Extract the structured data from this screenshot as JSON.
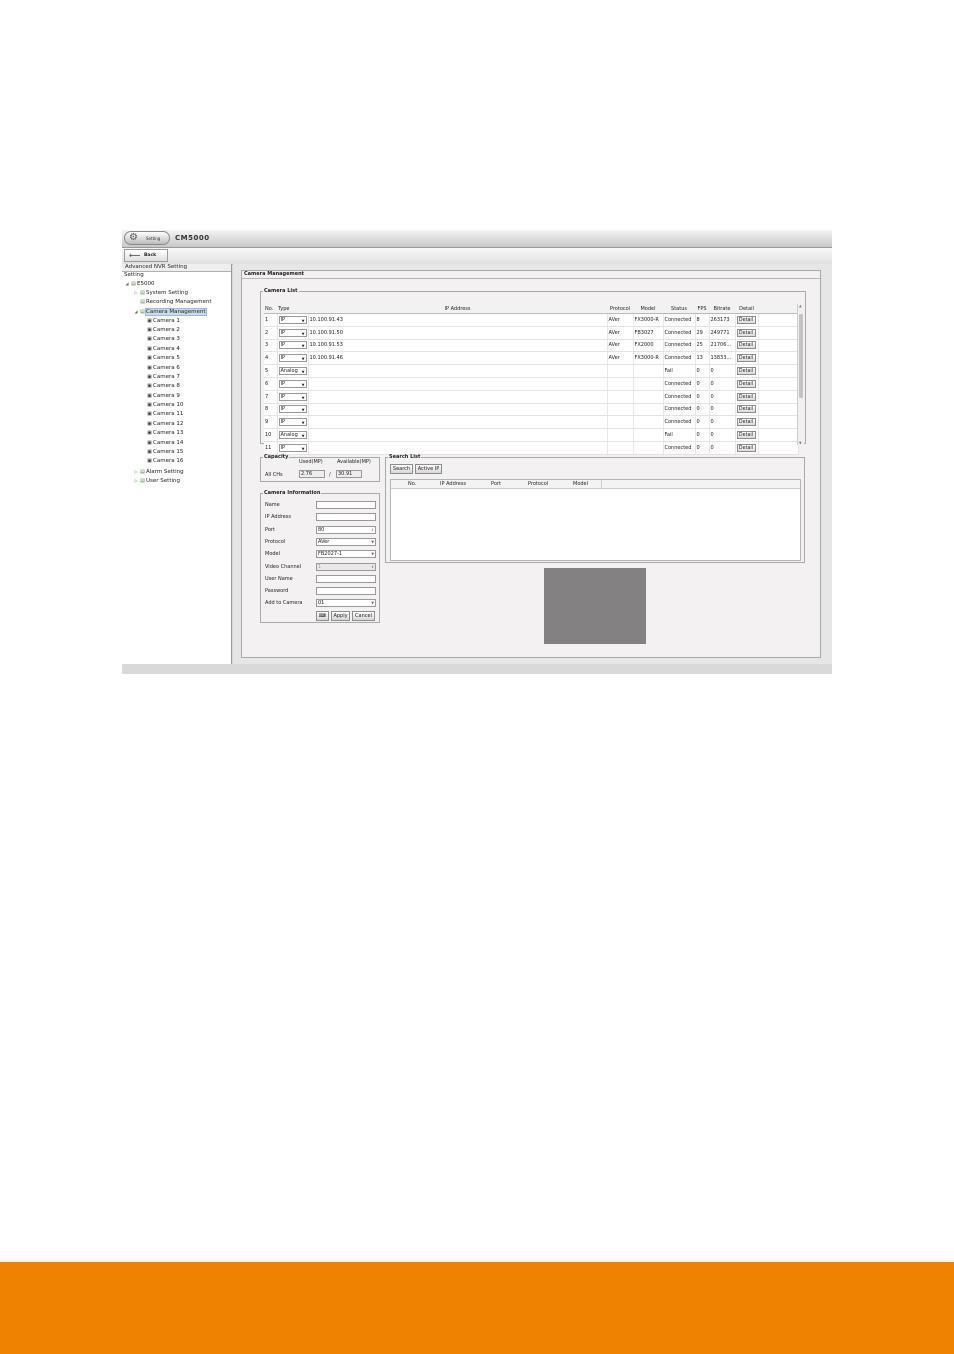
{
  "header": {
    "setting_label": "Setting",
    "app_title": "CM5000",
    "back_label": "Back"
  },
  "sidebar": {
    "header": "Advanced NVR Setting",
    "sub": "Setting",
    "tree": [
      {
        "label": "E5000",
        "level": 0,
        "arrow": "◢"
      },
      {
        "label": "System Setting",
        "level": 1,
        "arrow": "▷"
      },
      {
        "label": "Recording Management",
        "level": 1,
        "arrow": ""
      },
      {
        "label": "Camera Management",
        "level": 1,
        "arrow": "◢",
        "selected": true
      },
      {
        "label": "Camera 1",
        "level": 2
      },
      {
        "label": "Camera 2",
        "level": 2
      },
      {
        "label": "Camera 3",
        "level": 2
      },
      {
        "label": "Camera 4",
        "level": 2
      },
      {
        "label": "Camera 5",
        "level": 2
      },
      {
        "label": "Camera 6",
        "level": 2
      },
      {
        "label": "Camera 7",
        "level": 2
      },
      {
        "label": "Camera 8",
        "level": 2
      },
      {
        "label": "Camera 9",
        "level": 2
      },
      {
        "label": "Camera 10",
        "level": 2
      },
      {
        "label": "Camera 11",
        "level": 2
      },
      {
        "label": "Camera 12",
        "level": 2
      },
      {
        "label": "Camera 13",
        "level": 2
      },
      {
        "label": "Camera 14",
        "level": 2
      },
      {
        "label": "Camera 15",
        "level": 2
      },
      {
        "label": "Camera 16",
        "level": 2
      },
      {
        "label": "Alarm Setting",
        "level": 1,
        "arrow": "▷"
      },
      {
        "label": "User Setting",
        "level": 1,
        "arrow": "▷"
      }
    ]
  },
  "panel": {
    "title": "Camera Management"
  },
  "camera_list": {
    "legend": "Camera List",
    "columns": [
      "No.",
      "Type",
      "IP Address",
      "Protocol",
      "Model",
      "Status",
      "FPS",
      "Bitrate",
      "Detail"
    ],
    "detail_label": "Detail",
    "rows": [
      {
        "no": "1",
        "type": "IP",
        "ip": "10.100.91.43",
        "protocol": "AVer",
        "model": "FX3000-R",
        "status": "Connected",
        "fps": "8",
        "bitrate": "263173"
      },
      {
        "no": "2",
        "type": "IP",
        "ip": "10.100.91.50",
        "protocol": "AVer",
        "model": "FB3027",
        "status": "Connected",
        "fps": "29",
        "bitrate": "249771"
      },
      {
        "no": "3",
        "type": "IP",
        "ip": "10.100.91.53",
        "protocol": "AVer",
        "model": "FX2000",
        "status": "Connected",
        "fps": "25",
        "bitrate": "21706..."
      },
      {
        "no": "4",
        "type": "IP",
        "ip": "10.100.91.46",
        "protocol": "AVer",
        "model": "FX3000-R",
        "status": "Connected",
        "fps": "13",
        "bitrate": "13833..."
      },
      {
        "no": "5",
        "type": "Analog",
        "ip": "",
        "protocol": "",
        "model": "",
        "status": "Fail",
        "fps": "0",
        "bitrate": "0"
      },
      {
        "no": "6",
        "type": "IP",
        "ip": "",
        "protocol": "",
        "model": "",
        "status": "Connected",
        "fps": "0",
        "bitrate": "0"
      },
      {
        "no": "7",
        "type": "IP",
        "ip": "",
        "protocol": "",
        "model": "",
        "status": "Connected",
        "fps": "0",
        "bitrate": "0"
      },
      {
        "no": "8",
        "type": "IP",
        "ip": "",
        "protocol": "",
        "model": "",
        "status": "Connected",
        "fps": "0",
        "bitrate": "0"
      },
      {
        "no": "9",
        "type": "IP",
        "ip": "",
        "protocol": "",
        "model": "",
        "status": "Connected",
        "fps": "0",
        "bitrate": "0"
      },
      {
        "no": "10",
        "type": "Analog",
        "ip": "",
        "protocol": "",
        "model": "",
        "status": "Fail",
        "fps": "0",
        "bitrate": "0"
      },
      {
        "no": "11",
        "type": "IP",
        "ip": "",
        "protocol": "",
        "model": "",
        "status": "Connected",
        "fps": "0",
        "bitrate": "0"
      }
    ]
  },
  "capacity": {
    "legend": "Capacity",
    "used_label": "Used(MP)",
    "available_label": "Available(MP)",
    "row_label": "All CHs",
    "used_value": "2.76",
    "separator": "/",
    "available_value": "30.91"
  },
  "camera_info": {
    "legend": "Camera Information",
    "fields": [
      {
        "label": "Name",
        "value": "",
        "kind": "text"
      },
      {
        "label": "IP Address",
        "value": "",
        "kind": "text"
      },
      {
        "label": "Port",
        "value": "80",
        "kind": "spin"
      },
      {
        "label": "Protocol",
        "value": "AVer",
        "kind": "select"
      },
      {
        "label": "Model",
        "value": "FB2027-1",
        "kind": "select"
      },
      {
        "label": "Video Channel",
        "value": "1",
        "kind": "disabled"
      },
      {
        "label": "User Name",
        "value": "",
        "kind": "text"
      },
      {
        "label": "Password",
        "value": "",
        "kind": "text"
      },
      {
        "label": "Add to Camera",
        "value": "01",
        "kind": "select"
      }
    ],
    "apply_label": "Apply",
    "cancel_label": "Cancel"
  },
  "search_list": {
    "legend": "Search List",
    "search_label": "Search",
    "active_ip_label": "Active IP",
    "columns": [
      "No.",
      "IP Address",
      "Port",
      "Protocol",
      "Model"
    ]
  },
  "colors": {
    "footer": "#ef8200",
    "preview": "#838181",
    "selection": "#c9daf3"
  }
}
